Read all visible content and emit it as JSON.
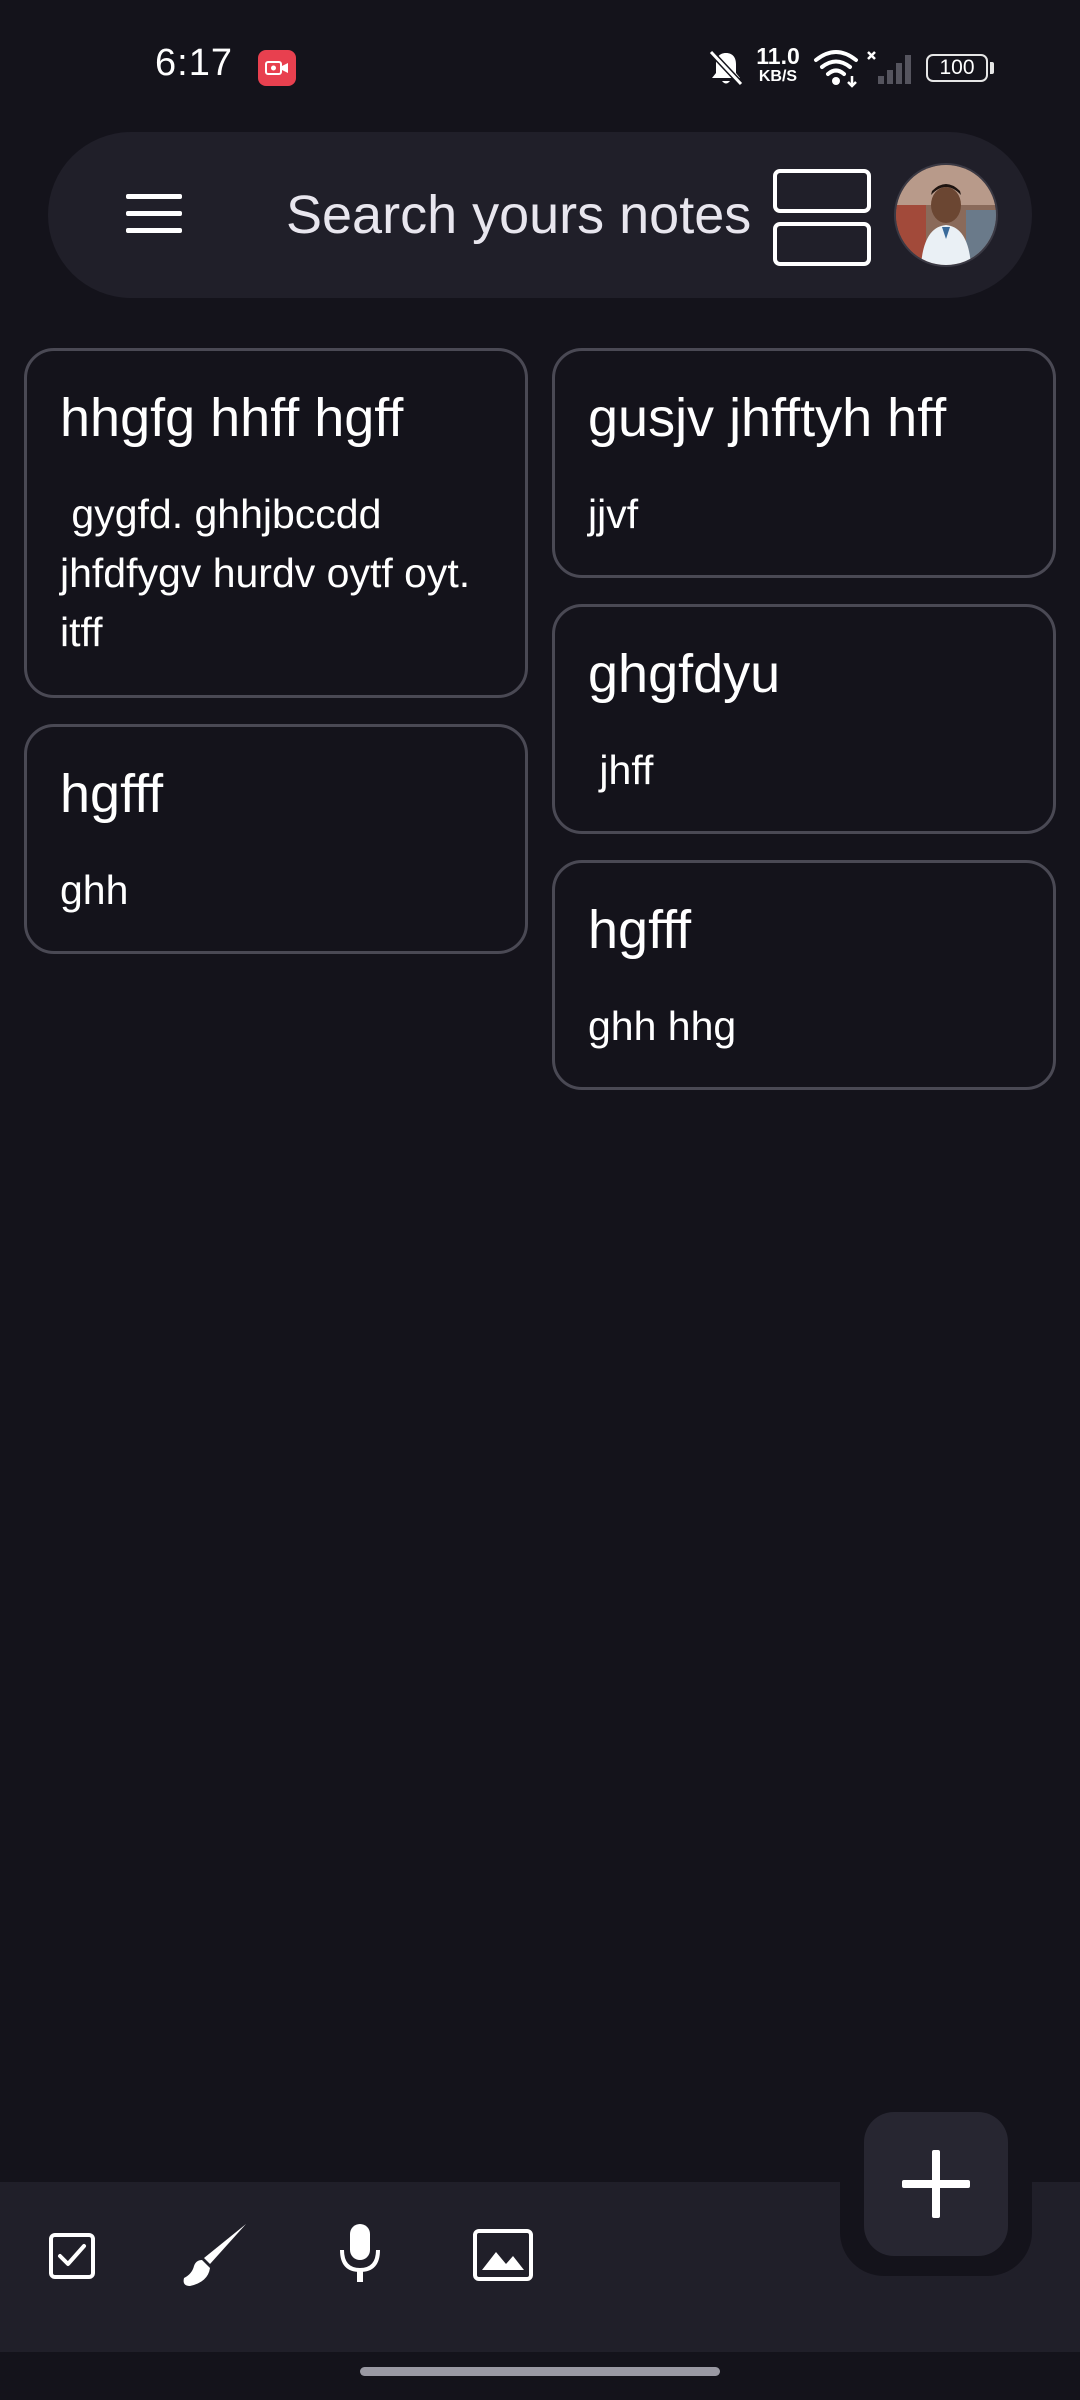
{
  "status_bar": {
    "time": "6:17",
    "net_speed_value": "11.0",
    "net_speed_unit": "KB/S",
    "battery": "100"
  },
  "search": {
    "placeholder": "Search yours notes"
  },
  "notes": [
    {
      "title": "hhgfg hhff hgff",
      "body": " gygfd. ghhjbccdd\njhfdfygv hurdv oytf oyt.\nitff"
    },
    {
      "title": "gusjv jhfftyh hff",
      "body": "jjvf"
    },
    {
      "title": "hgfff",
      "body": "ghh"
    },
    {
      "title": "ghgfdyu",
      "body": " jhff"
    },
    {
      "title": "hgfff",
      "body": "ghh hhg"
    }
  ],
  "toolbar": {
    "icons": [
      "checkbox-icon",
      "brush-icon",
      "microphone-icon",
      "image-icon"
    ],
    "fab_icon": "plus-icon"
  },
  "colors": {
    "background": "#14131b",
    "surface": "#201f29",
    "card_border": "#4a4954",
    "recording_indicator": "#e8404f"
  }
}
